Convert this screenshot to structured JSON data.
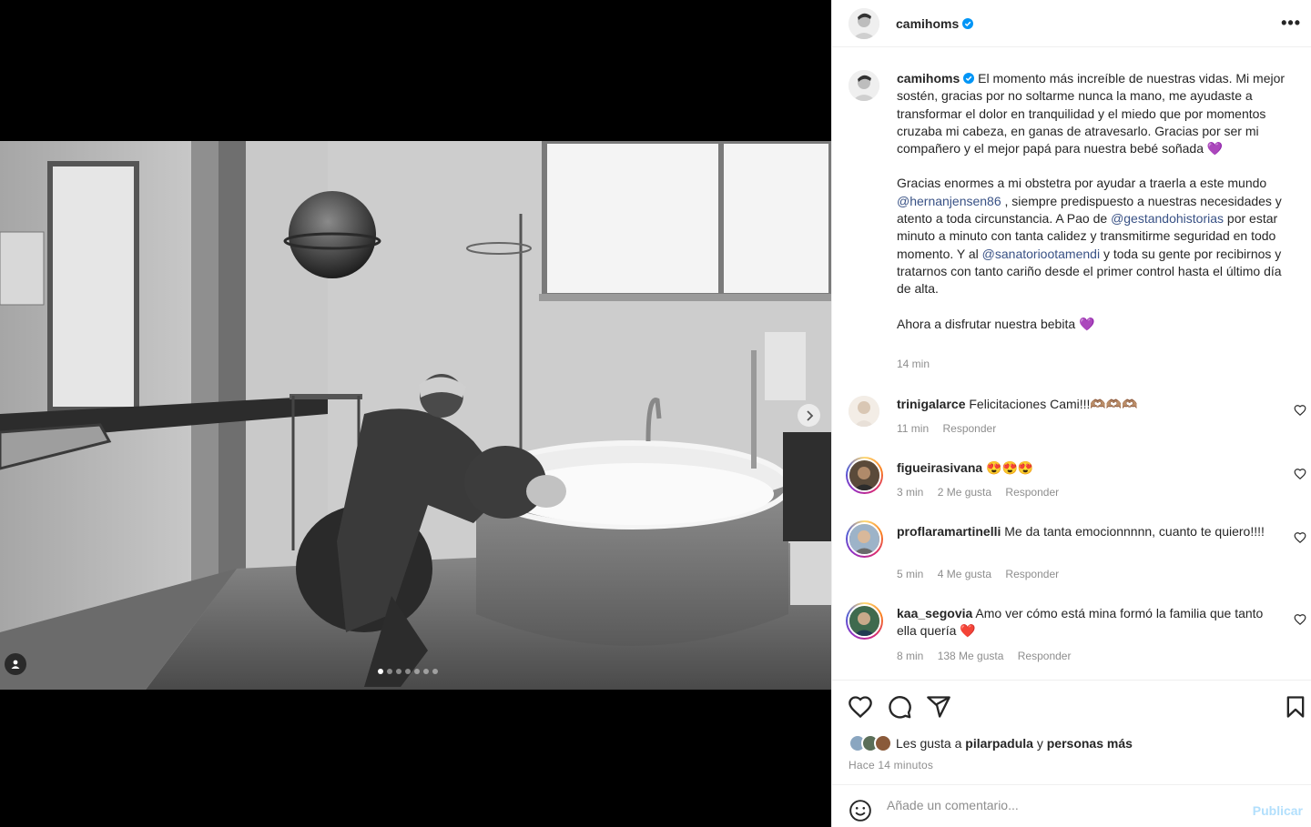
{
  "post": {
    "username": "camihoms",
    "more_label": "•••",
    "caption": {
      "p1": "El momento más increíble de nuestras vidas. Mi mejor sostén, gracias por no soltarme nunca la mano, me ayudaste a transformar el dolor en tranquilidad y el miedo que por momentos cruzaba mi cabeza, en ganas de atravesarlo. Gracias por ser mi compañero y el mejor papá para nuestra bebé soñada",
      "p1_emoji": "💜",
      "p2_a": "Gracias enormes a mi obstetra por ayudar a traerla a este mundo ",
      "mention1": "@hernanjensen86",
      "p2_b": " , siempre predispuesto a nuestras necesidades y atento a toda circunstancia. A Pao de ",
      "mention2": "@gestandohistorias",
      "p2_c": " por estar minuto a minuto con tanta calidez y transmitirme seguridad en todo momento. Y al ",
      "mention3": "@sanatoriootamendi",
      "p2_d": " y toda su gente por recibirnos y tratarnos con tanto cariño desde el primer control hasta el último día de alta.",
      "p3": "Ahora a disfrutar nuestra bebita",
      "p3_emoji": "💜"
    },
    "caption_time": "14 min"
  },
  "comments": [
    {
      "user": "trinigalarce",
      "text": "Felicitaciones Cami!!!🫶🏽🫶🏽🫶🏽",
      "time": "11 min",
      "likes": "",
      "reply": "Responder"
    },
    {
      "user": "figueirasivana",
      "text": "😍😍😍",
      "time": "3 min",
      "likes": "2 Me gusta",
      "reply": "Responder"
    },
    {
      "user": "proflaramartinelli",
      "text": "Me da tanta emocionnnnn, cuanto te quiero!!!!",
      "time": "5 min",
      "likes": "4 Me gusta",
      "reply": "Responder"
    },
    {
      "user": "kaa_segovia",
      "text": "Amo ver cómo está mina formó la familia que tanto ella quería ❤️",
      "time": "8 min",
      "likes": "138 Me gusta",
      "reply": "Responder"
    }
  ],
  "likes": {
    "prefix": "Les gusta a",
    "user": "pilarpadula",
    "mid": "y",
    "suffix": "personas más"
  },
  "posted_ago": "Hace 14 minutos",
  "comment_box": {
    "placeholder": "Añade un comentario...",
    "publish": "Publicar"
  },
  "carousel": {
    "count": 7,
    "active": 0
  },
  "colors": {
    "mention": "#385185",
    "verified": "#0095f6",
    "publish": "#b2dffc",
    "heart": "#ed4956"
  },
  "icons": [
    "next-arrow-icon",
    "tagged-user-icon",
    "verified-icon",
    "like-icon",
    "comment-icon",
    "share-icon",
    "save-icon",
    "emoji-icon"
  ]
}
